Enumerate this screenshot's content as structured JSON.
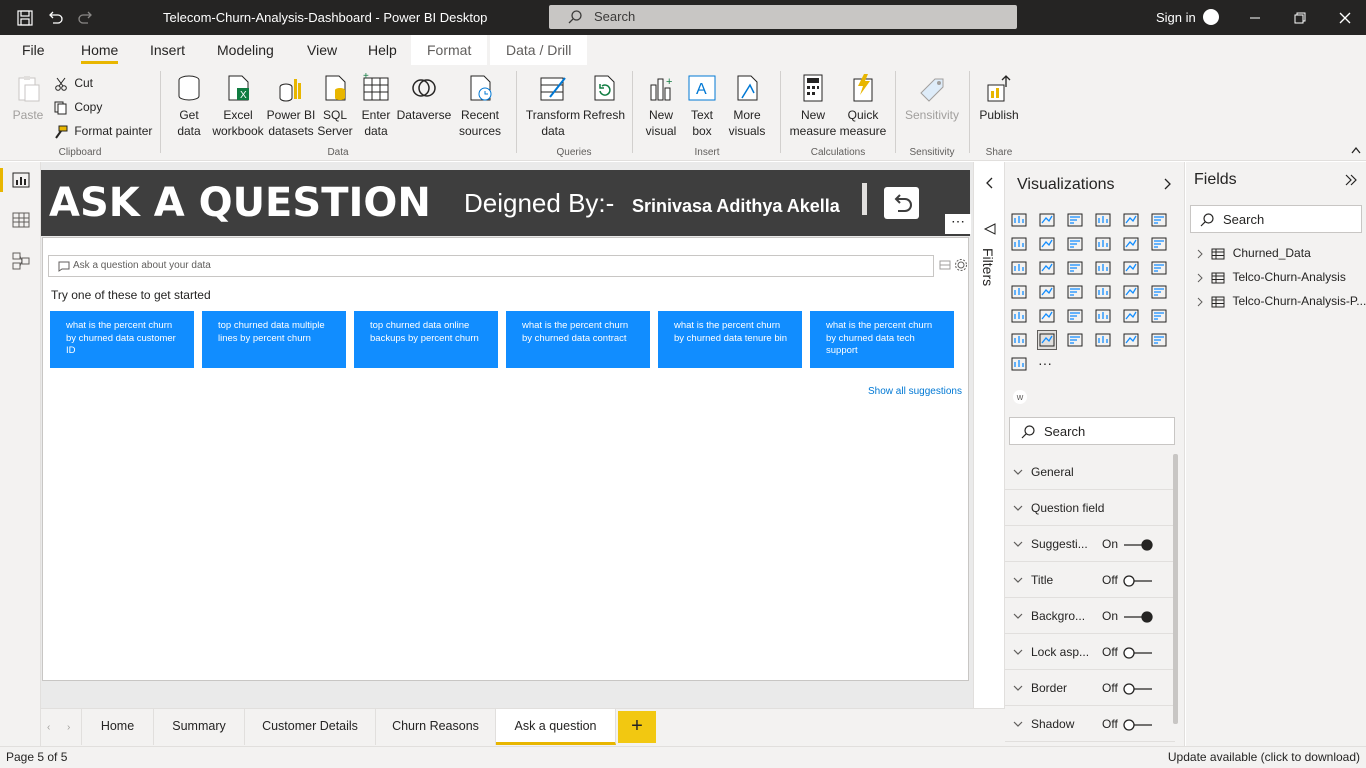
{
  "window": {
    "title": "Telecom-Churn-Analysis-Dashboard - Power BI Desktop",
    "search_placeholder": "Search",
    "sign_in": "Sign in"
  },
  "menu": {
    "tabs": [
      "File",
      "Home",
      "Insert",
      "Modeling",
      "View",
      "Help"
    ],
    "active": "Home",
    "context_tabs": [
      "Format",
      "Data / Drill"
    ]
  },
  "ribbon": {
    "clipboard": {
      "paste": "Paste",
      "cut": "Cut",
      "copy": "Copy",
      "format_painter": "Format painter",
      "group": "Clipboard"
    },
    "data": {
      "get_data": [
        "Get",
        "data"
      ],
      "excel": [
        "Excel",
        "workbook"
      ],
      "pbi_datasets": [
        "Power BI",
        "datasets"
      ],
      "sql": [
        "SQL",
        "Server"
      ],
      "enter_data": [
        "Enter",
        "data"
      ],
      "dataverse": "Dataverse",
      "recent": [
        "Recent",
        "sources"
      ],
      "group": "Data"
    },
    "queries": {
      "transform": [
        "Transform",
        "data"
      ],
      "refresh": "Refresh",
      "group": "Queries"
    },
    "insert": {
      "new_visual": [
        "New",
        "visual"
      ],
      "text_box": [
        "Text",
        "box"
      ],
      "more_visuals": [
        "More",
        "visuals"
      ],
      "group": "Insert"
    },
    "calculations": {
      "new_measure": [
        "New",
        "measure"
      ],
      "quick_measure": [
        "Quick",
        "measure"
      ],
      "group": "Calculations"
    },
    "sensitivity": {
      "label": "Sensitivity",
      "group": "Sensitivity"
    },
    "share": {
      "publish": "Publish",
      "group": "Share"
    }
  },
  "banner": {
    "title": "ASK A QUESTION",
    "designed_label": "Deigned By:-",
    "designer": "Srinivasa Adithya Akella"
  },
  "qa": {
    "placeholder": "Ask a question about your data",
    "try_text": "Try one of these to get started",
    "suggestions": [
      "what is the percent churn by churned data customer ID",
      "top churned data multiple lines by percent churn",
      "top churned data online backups by percent churn",
      "what is the percent churn by churned data contract",
      "what is the percent churn by churned data tenure bin",
      "what is the percent churn by churned data tech support"
    ],
    "show_all": "Show all suggestions"
  },
  "filters": {
    "label": "Filters"
  },
  "visualizations": {
    "title": "Visualizations",
    "search_placeholder": "Search",
    "format_sections": [
      {
        "label": "General",
        "state": "",
        "toggle": null
      },
      {
        "label": "Question field",
        "state": "",
        "toggle": null
      },
      {
        "label": "Suggesti...",
        "state": "On",
        "toggle": true
      },
      {
        "label": "Title",
        "state": "Off",
        "toggle": false
      },
      {
        "label": "Backgro...",
        "state": "On",
        "toggle": true
      },
      {
        "label": "Lock asp...",
        "state": "Off",
        "toggle": false
      },
      {
        "label": "Border",
        "state": "Off",
        "toggle": false
      },
      {
        "label": "Shadow",
        "state": "Off",
        "toggle": false
      }
    ]
  },
  "fields": {
    "title": "Fields",
    "search_placeholder": "Search",
    "tables": [
      "Churned_Data",
      "Telco-Churn-Analysis",
      "Telco-Churn-Analysis-P..."
    ]
  },
  "pages": {
    "tabs": [
      "Home",
      "Summary",
      "Customer Details",
      "Churn Reasons",
      "Ask a question"
    ],
    "active": "Ask a question",
    "add": "+"
  },
  "status": {
    "page": "Page 5 of 5",
    "update": "Update available (click to download)"
  },
  "colors": {
    "accent": "#e8b600",
    "suggestion_bg": "#118dff",
    "banner_bg": "#3e3e3e",
    "titlebar": "#252423"
  }
}
